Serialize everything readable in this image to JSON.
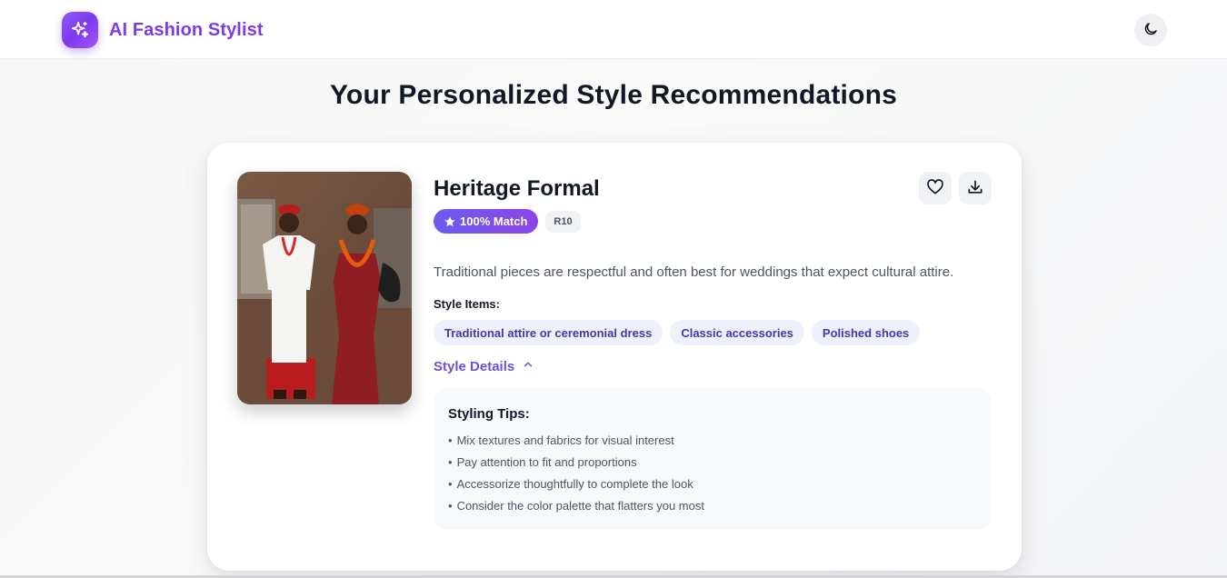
{
  "header": {
    "app_name": "AI Fashion Stylist",
    "logo_icon": "sparkles-icon",
    "theme_toggle_icon": "moon-icon"
  },
  "page_title": "Your Personalized Style Recommendations",
  "recommendation": {
    "title": "Heritage Formal",
    "match_label": "100% Match",
    "match_icon": "star-icon",
    "code": "R10",
    "description": "Traditional pieces are respectful and often best for weddings that expect cultural attire.",
    "style_items_label": "Style Items:",
    "style_items": [
      "Traditional attire or ceremonial dress",
      "Classic accessories",
      "Polished shoes"
    ],
    "details_toggle_label": "Style Details",
    "styling_tips_title": "Styling Tips:",
    "styling_tips": [
      "Mix textures and fabrics for visual interest",
      "Pay attention to fit and proportions",
      "Accessorize thoughtfully to complete the look",
      "Consider the color palette that flatters you most"
    ],
    "actions": {
      "favorite_icon": "heart-icon",
      "download_icon": "download-icon"
    }
  },
  "colors": {
    "brand": "#7c3aed",
    "match_gradient_start": "#6d5cf0",
    "match_gradient_end": "#8b46e8",
    "chip_bg": "#eef0fb",
    "chip_text": "#3f3aa8"
  }
}
